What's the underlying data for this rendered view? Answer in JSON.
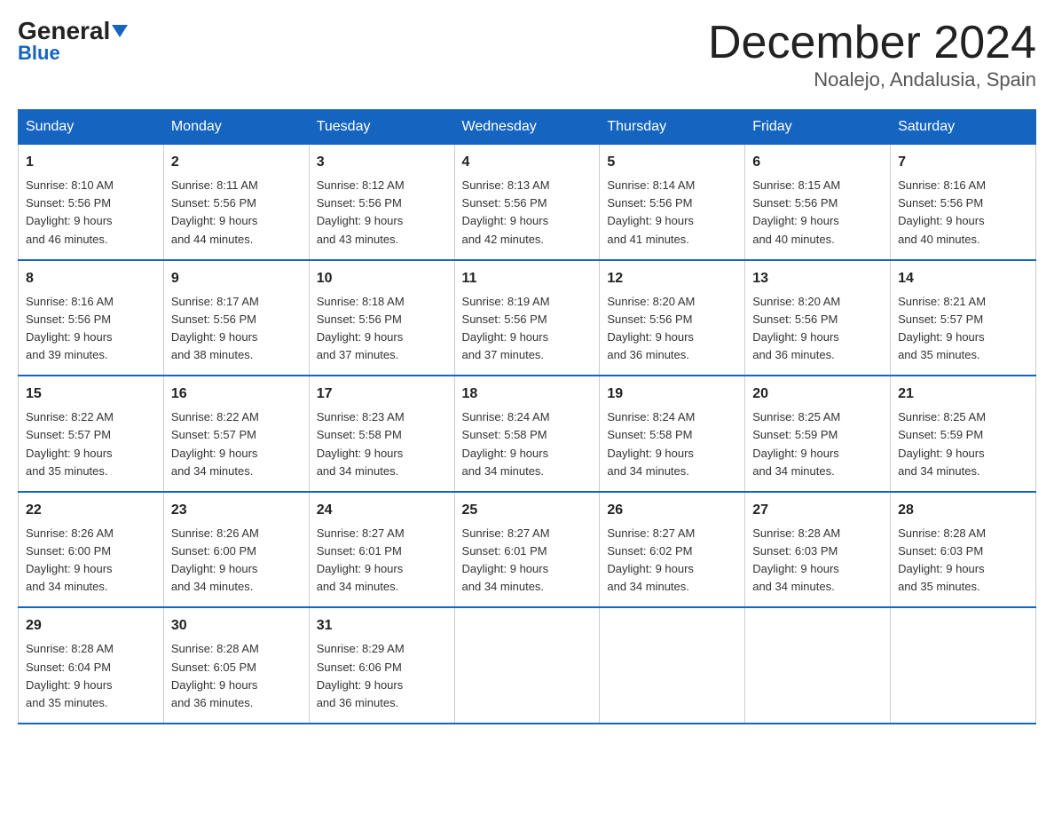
{
  "logo": {
    "name": "General",
    "name2": "Blue"
  },
  "title": "December 2024",
  "location": "Noalejo, Andalusia, Spain",
  "weekdays": [
    "Sunday",
    "Monday",
    "Tuesday",
    "Wednesday",
    "Thursday",
    "Friday",
    "Saturday"
  ],
  "weeks": [
    [
      {
        "day": "1",
        "sunrise": "8:10 AM",
        "sunset": "5:56 PM",
        "daylight": "9 hours and 46 minutes."
      },
      {
        "day": "2",
        "sunrise": "8:11 AM",
        "sunset": "5:56 PM",
        "daylight": "9 hours and 44 minutes."
      },
      {
        "day": "3",
        "sunrise": "8:12 AM",
        "sunset": "5:56 PM",
        "daylight": "9 hours and 43 minutes."
      },
      {
        "day": "4",
        "sunrise": "8:13 AM",
        "sunset": "5:56 PM",
        "daylight": "9 hours and 42 minutes."
      },
      {
        "day": "5",
        "sunrise": "8:14 AM",
        "sunset": "5:56 PM",
        "daylight": "9 hours and 41 minutes."
      },
      {
        "day": "6",
        "sunrise": "8:15 AM",
        "sunset": "5:56 PM",
        "daylight": "9 hours and 40 minutes."
      },
      {
        "day": "7",
        "sunrise": "8:16 AM",
        "sunset": "5:56 PM",
        "daylight": "9 hours and 40 minutes."
      }
    ],
    [
      {
        "day": "8",
        "sunrise": "8:16 AM",
        "sunset": "5:56 PM",
        "daylight": "9 hours and 39 minutes."
      },
      {
        "day": "9",
        "sunrise": "8:17 AM",
        "sunset": "5:56 PM",
        "daylight": "9 hours and 38 minutes."
      },
      {
        "day": "10",
        "sunrise": "8:18 AM",
        "sunset": "5:56 PM",
        "daylight": "9 hours and 37 minutes."
      },
      {
        "day": "11",
        "sunrise": "8:19 AM",
        "sunset": "5:56 PM",
        "daylight": "9 hours and 37 minutes."
      },
      {
        "day": "12",
        "sunrise": "8:20 AM",
        "sunset": "5:56 PM",
        "daylight": "9 hours and 36 minutes."
      },
      {
        "day": "13",
        "sunrise": "8:20 AM",
        "sunset": "5:56 PM",
        "daylight": "9 hours and 36 minutes."
      },
      {
        "day": "14",
        "sunrise": "8:21 AM",
        "sunset": "5:57 PM",
        "daylight": "9 hours and 35 minutes."
      }
    ],
    [
      {
        "day": "15",
        "sunrise": "8:22 AM",
        "sunset": "5:57 PM",
        "daylight": "9 hours and 35 minutes."
      },
      {
        "day": "16",
        "sunrise": "8:22 AM",
        "sunset": "5:57 PM",
        "daylight": "9 hours and 34 minutes."
      },
      {
        "day": "17",
        "sunrise": "8:23 AM",
        "sunset": "5:58 PM",
        "daylight": "9 hours and 34 minutes."
      },
      {
        "day": "18",
        "sunrise": "8:24 AM",
        "sunset": "5:58 PM",
        "daylight": "9 hours and 34 minutes."
      },
      {
        "day": "19",
        "sunrise": "8:24 AM",
        "sunset": "5:58 PM",
        "daylight": "9 hours and 34 minutes."
      },
      {
        "day": "20",
        "sunrise": "8:25 AM",
        "sunset": "5:59 PM",
        "daylight": "9 hours and 34 minutes."
      },
      {
        "day": "21",
        "sunrise": "8:25 AM",
        "sunset": "5:59 PM",
        "daylight": "9 hours and 34 minutes."
      }
    ],
    [
      {
        "day": "22",
        "sunrise": "8:26 AM",
        "sunset": "6:00 PM",
        "daylight": "9 hours and 34 minutes."
      },
      {
        "day": "23",
        "sunrise": "8:26 AM",
        "sunset": "6:00 PM",
        "daylight": "9 hours and 34 minutes."
      },
      {
        "day": "24",
        "sunrise": "8:27 AM",
        "sunset": "6:01 PM",
        "daylight": "9 hours and 34 minutes."
      },
      {
        "day": "25",
        "sunrise": "8:27 AM",
        "sunset": "6:01 PM",
        "daylight": "9 hours and 34 minutes."
      },
      {
        "day": "26",
        "sunrise": "8:27 AM",
        "sunset": "6:02 PM",
        "daylight": "9 hours and 34 minutes."
      },
      {
        "day": "27",
        "sunrise": "8:28 AM",
        "sunset": "6:03 PM",
        "daylight": "9 hours and 34 minutes."
      },
      {
        "day": "28",
        "sunrise": "8:28 AM",
        "sunset": "6:03 PM",
        "daylight": "9 hours and 35 minutes."
      }
    ],
    [
      {
        "day": "29",
        "sunrise": "8:28 AM",
        "sunset": "6:04 PM",
        "daylight": "9 hours and 35 minutes."
      },
      {
        "day": "30",
        "sunrise": "8:28 AM",
        "sunset": "6:05 PM",
        "daylight": "9 hours and 36 minutes."
      },
      {
        "day": "31",
        "sunrise": "8:29 AM",
        "sunset": "6:06 PM",
        "daylight": "9 hours and 36 minutes."
      },
      null,
      null,
      null,
      null
    ]
  ]
}
